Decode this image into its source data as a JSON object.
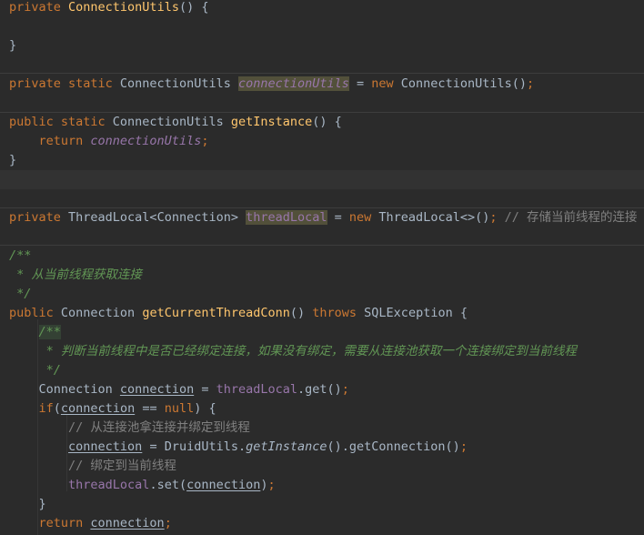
{
  "editor": {
    "lines": [
      [
        {
          "text": "private ",
          "s": "kw"
        },
        {
          "text": "ConnectionUtils",
          "s": "fn"
        },
        {
          "text": "() {",
          "s": "plain"
        }
      ],
      [],
      [
        {
          "text": "}",
          "s": "plain"
        }
      ],
      [],
      [
        {
          "text": "private static ",
          "s": "kw"
        },
        {
          "text": "ConnectionUtils ",
          "s": "plain"
        },
        {
          "text": "connectionUtils",
          "s": "fieldi hl"
        },
        {
          "text": " = ",
          "s": "plain"
        },
        {
          "text": "new ",
          "s": "kw"
        },
        {
          "text": "ConnectionUtils()",
          "s": "plain"
        },
        {
          "text": ";",
          "s": "kw"
        }
      ],
      [],
      [
        {
          "text": "public static ",
          "s": "kw"
        },
        {
          "text": "ConnectionUtils ",
          "s": "plain"
        },
        {
          "text": "getInstance",
          "s": "fn"
        },
        {
          "text": "() {",
          "s": "plain"
        }
      ],
      [
        {
          "text": "    return ",
          "s": "kw"
        },
        {
          "text": "connectionUtils",
          "s": "fieldi"
        },
        {
          "text": ";",
          "s": "kw"
        }
      ],
      [
        {
          "text": "}",
          "s": "plain"
        }
      ],
      [],
      [],
      [
        {
          "text": "private ",
          "s": "kw"
        },
        {
          "text": "ThreadLocal<Connection> ",
          "s": "plain"
        },
        {
          "text": "threadLocal",
          "s": "field hl"
        },
        {
          "text": " = ",
          "s": "plain"
        },
        {
          "text": "new ",
          "s": "kw"
        },
        {
          "text": "ThreadLocal<>()",
          "s": "plain"
        },
        {
          "text": "; ",
          "s": "kw"
        },
        {
          "text": "// 存储当前线程的连接",
          "s": "comment"
        }
      ],
      [],
      [
        {
          "text": "/**",
          "s": "doc"
        }
      ],
      [
        {
          "text": " * 从当前线程获取连接",
          "s": "doc"
        }
      ],
      [
        {
          "text": " */",
          "s": "doc"
        }
      ],
      [
        {
          "text": "public ",
          "s": "kw"
        },
        {
          "text": "Connection ",
          "s": "plain"
        },
        {
          "text": "getCurrentThreadConn",
          "s": "fn"
        },
        {
          "text": "() ",
          "s": "plain"
        },
        {
          "text": "throws ",
          "s": "kw"
        },
        {
          "text": "SQLException {",
          "s": "plain"
        }
      ],
      [
        {
          "text": "    ",
          "s": "plain"
        },
        {
          "text": "/**",
          "s": "doc hlg"
        }
      ],
      [
        {
          "text": "     * 判断当前线程中是否已经绑定连接，如果没有绑定，需要从连接池获取一个连接绑定到当前线程",
          "s": "doc"
        }
      ],
      [
        {
          "text": "     */",
          "s": "doc"
        }
      ],
      [
        {
          "text": "    Connection ",
          "s": "plain"
        },
        {
          "text": "connection",
          "s": "plain under"
        },
        {
          "text": " = ",
          "s": "plain"
        },
        {
          "text": "threadLocal",
          "s": "field"
        },
        {
          "text": ".get()",
          "s": "plain"
        },
        {
          "text": ";",
          "s": "kw"
        }
      ],
      [
        {
          "text": "    ",
          "s": "plain"
        },
        {
          "text": "if",
          "s": "kw"
        },
        {
          "text": "(",
          "s": "plain"
        },
        {
          "text": "connection",
          "s": "plain under"
        },
        {
          "text": " == ",
          "s": "plain"
        },
        {
          "text": "null",
          "s": "kw"
        },
        {
          "text": ") {",
          "s": "plain"
        }
      ],
      [
        {
          "text": "        // 从连接池拿连接并绑定到线程",
          "s": "comment"
        }
      ],
      [
        {
          "text": "        ",
          "s": "plain"
        },
        {
          "text": "connection",
          "s": "plain under"
        },
        {
          "text": " = DruidUtils.",
          "s": "plain"
        },
        {
          "text": "getInstance",
          "s": "plain italic"
        },
        {
          "text": "().getConnection()",
          "s": "plain"
        },
        {
          "text": ";",
          "s": "kw"
        }
      ],
      [
        {
          "text": "        // 绑定到当前线程",
          "s": "comment"
        }
      ],
      [
        {
          "text": "        ",
          "s": "plain"
        },
        {
          "text": "threadLocal",
          "s": "field"
        },
        {
          "text": ".set(",
          "s": "plain"
        },
        {
          "text": "connection",
          "s": "plain under"
        },
        {
          "text": ")",
          "s": "plain"
        },
        {
          "text": ";",
          "s": "kw"
        }
      ],
      [
        {
          "text": "    }",
          "s": "plain"
        }
      ],
      [
        {
          "text": "    return ",
          "s": "kw"
        },
        {
          "text": "connection",
          "s": "plain under"
        },
        {
          "text": ";",
          "s": "kw"
        }
      ]
    ]
  }
}
